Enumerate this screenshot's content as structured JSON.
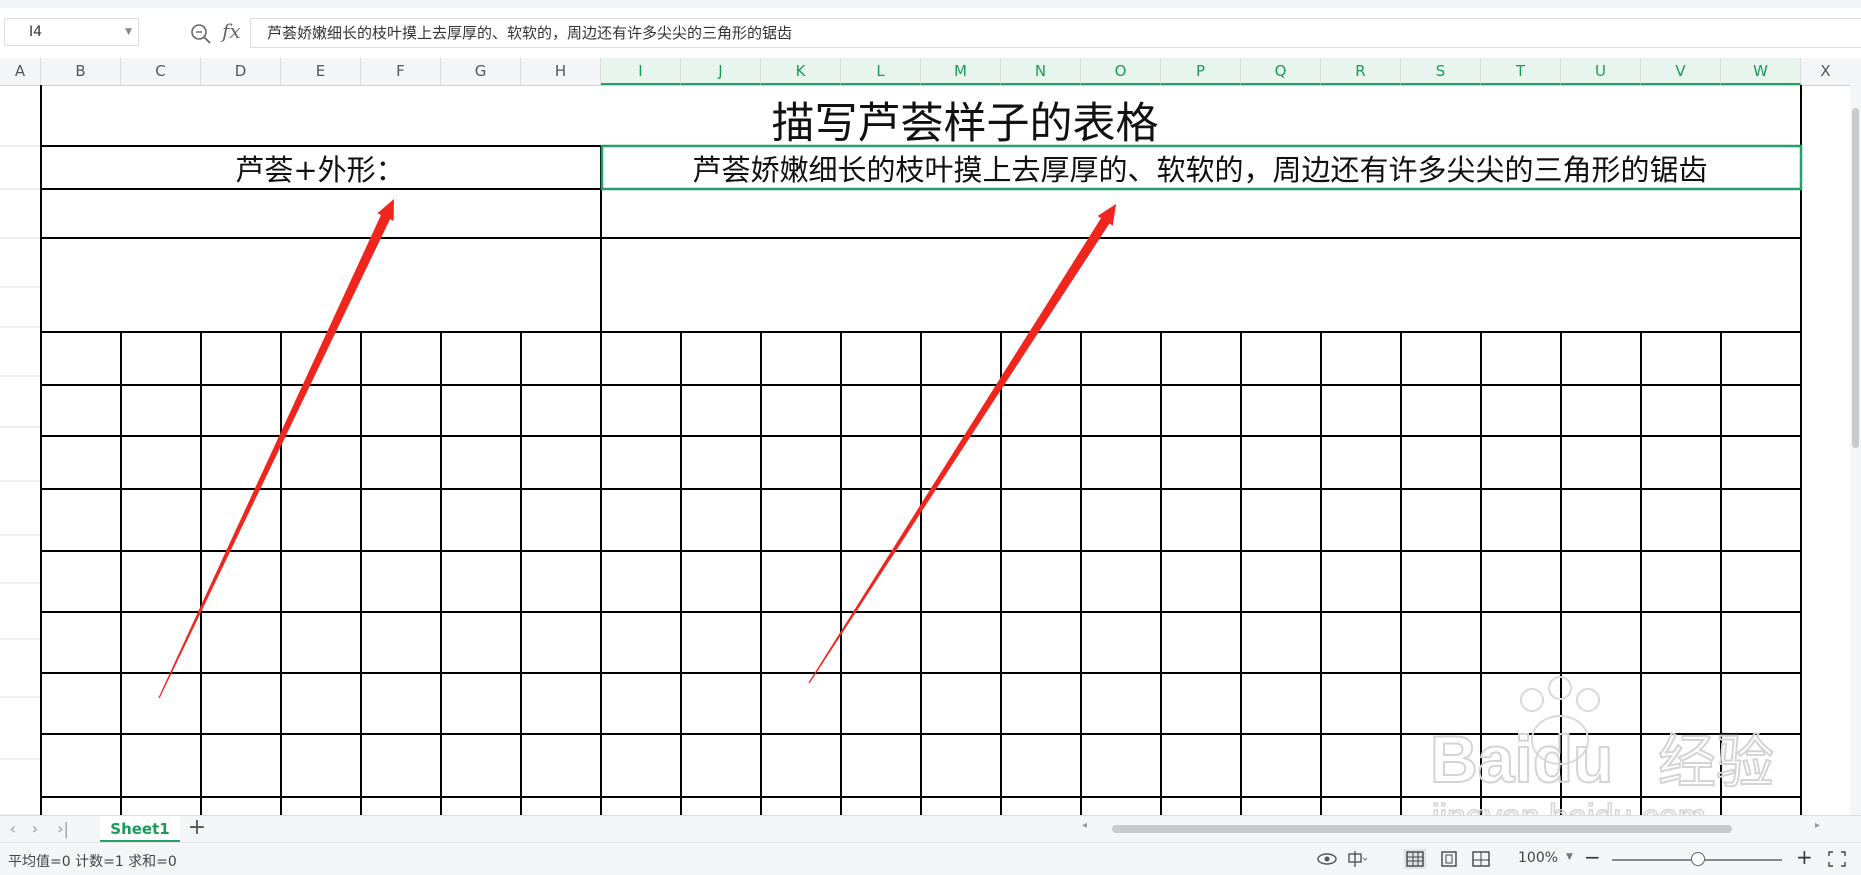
{
  "formula_bar": {
    "cell_ref": "I4",
    "fx_label": "fx",
    "content": "芦荟娇嫩细长的枝叶摸上去厚厚的、软软的，周边还有许多尖尖的三角形的锯齿"
  },
  "columns": [
    "A",
    "B",
    "C",
    "D",
    "E",
    "F",
    "G",
    "H",
    "I",
    "J",
    "K",
    "L",
    "M",
    "N",
    "O",
    "P",
    "Q",
    "R",
    "S",
    "T",
    "U",
    "V",
    "W"
  ],
  "table": {
    "title": "描写芦荟样子的表格",
    "label_cell": "芦荟+外形：",
    "description_cell": "芦荟娇嫩细长的枝叶摸上去厚厚的、软软的，周边还有许多尖尖的三角形的锯齿"
  },
  "sheet_tabs": {
    "active": "Sheet1",
    "add_label": "+"
  },
  "status": {
    "summary": "平均值=0  计数=1  求和=0",
    "zoom": "100%",
    "zoom_fraction": 0.5
  },
  "watermark": {
    "brand": "Baidu",
    "suffix": "经验",
    "url": "jingyan.baidu.com"
  },
  "colors": {
    "accent": "#22a066",
    "arrow": "#f0261e",
    "grid_line": "#000000"
  }
}
